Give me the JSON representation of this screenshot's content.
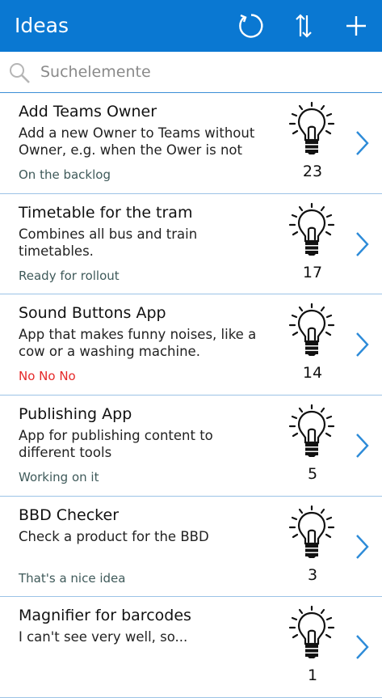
{
  "header": {
    "title": "Ideas",
    "refresh_icon": "refresh-icon",
    "sort_icon": "sort-icon",
    "add_icon": "plus-icon",
    "background": "#0a78d2"
  },
  "search": {
    "placeholder": "Suchelemente",
    "value": ""
  },
  "ideas": [
    {
      "title": "Add Teams Owner",
      "description": "Add a new Owner to Teams without Owner, e.g. when the Ower is not",
      "status": "On the backlog",
      "votes": "23",
      "status_color": "#3f5a5a"
    },
    {
      "title": "Timetable for the tram",
      "description": "Combines all bus and train timetables.",
      "status": "Ready for rollout",
      "votes": "17",
      "status_color": "#3f5a5a"
    },
    {
      "title": "Sound Buttons App",
      "description": "App that makes funny noises, like a cow or a washing machine.",
      "status": "No No No",
      "votes": "14",
      "status_color": "#e52929"
    },
    {
      "title": "Publishing App",
      "description": "App for publishing content to different tools",
      "status": "Working on it",
      "votes": "5",
      "status_color": "#3f5a5a"
    },
    {
      "title": "BBD Checker",
      "description": "Check a product for the BBD",
      "status": "That's a nice idea",
      "votes": "3",
      "status_color": "#3f5a5a"
    },
    {
      "title": "Magnifier for barcodes",
      "description": "I can't see very well, so...",
      "status": "",
      "votes": "1",
      "status_color": "#3f5a5a"
    }
  ]
}
